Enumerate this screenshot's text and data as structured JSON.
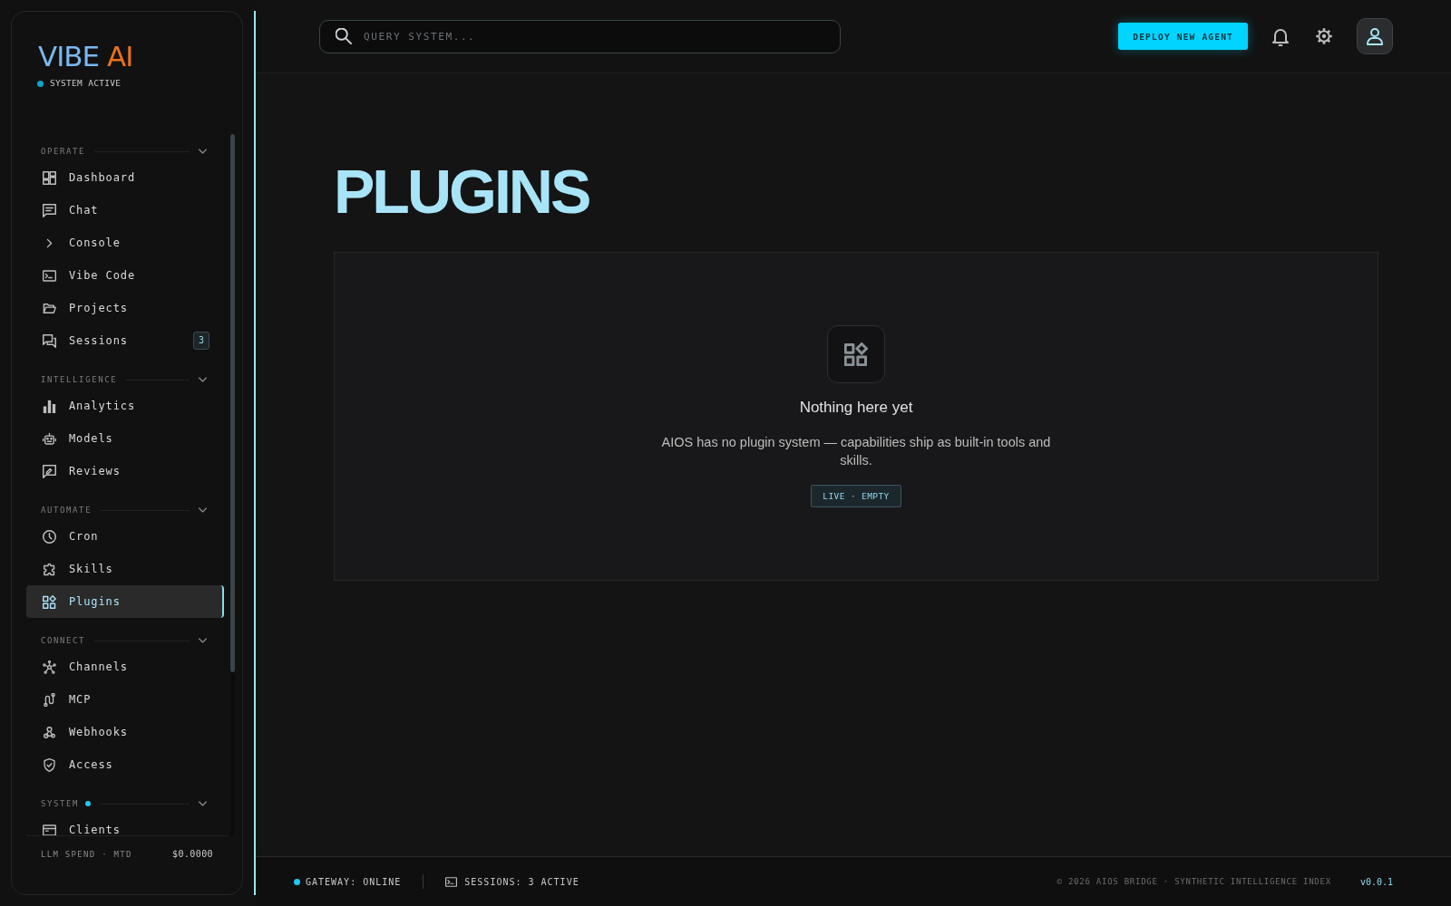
{
  "sidebar": {
    "brand": {
      "name": "VIBE",
      "accent": "AI"
    },
    "status": {
      "label": "SYSTEM ACTIVE",
      "online": true
    },
    "sections": [
      {
        "title": "OPERATE",
        "indicator": false,
        "expanded": true,
        "items": [
          {
            "label": "Dashboard",
            "selected": false
          },
          {
            "label": "Chat",
            "selected": false
          },
          {
            "label": "Console",
            "selected": false
          },
          {
            "label": "Vibe Code",
            "selected": false
          },
          {
            "label": "Projects",
            "selected": false
          },
          {
            "label": "Sessions",
            "selected": false,
            "badge": "3"
          }
        ]
      },
      {
        "title": "INTELLIGENCE",
        "indicator": false,
        "expanded": true,
        "items": [
          {
            "label": "Analytics",
            "selected": false
          },
          {
            "label": "Models",
            "selected": false
          },
          {
            "label": "Reviews",
            "selected": false
          }
        ]
      },
      {
        "title": "AUTOMATE",
        "indicator": false,
        "expanded": true,
        "items": [
          {
            "label": "Cron",
            "selected": false
          },
          {
            "label": "Skills",
            "selected": false
          },
          {
            "label": "Plugins",
            "selected": true
          }
        ]
      },
      {
        "title": "CONNECT",
        "indicator": false,
        "expanded": true,
        "items": [
          {
            "label": "Channels",
            "selected": false
          },
          {
            "label": "MCP",
            "selected": false
          },
          {
            "label": "Webhooks",
            "selected": false
          },
          {
            "label": "Access",
            "selected": false
          }
        ]
      },
      {
        "title": "SYSTEM",
        "indicator": true,
        "expanded": true,
        "items": [
          {
            "label": "Clients",
            "selected": false
          }
        ]
      }
    ],
    "spend": {
      "label": "LLM SPEND · MTD",
      "value": "$0.0000"
    }
  },
  "topbar": {
    "search": {
      "placeholder": "QUERY SYSTEM..."
    },
    "deploy_button": "DEPLOY NEW AGENT"
  },
  "page": {
    "title": "PLUGINS",
    "empty_state": {
      "heading": "Nothing here yet",
      "message": "AIOS has no plugin system — capabilities ship as built-in tools and skills.",
      "status": "LIVE · EMPTY"
    }
  },
  "status_bar": {
    "gateway": {
      "label": "GATEWAY: ONLINE",
      "online": true
    },
    "sessions": "SESSIONS: 3 ACTIVE",
    "copyright": "© 2026 AIOS BRIDGE · SYNTHETIC INTELLIGENCE INDEX",
    "version": "v0.0.1"
  }
}
